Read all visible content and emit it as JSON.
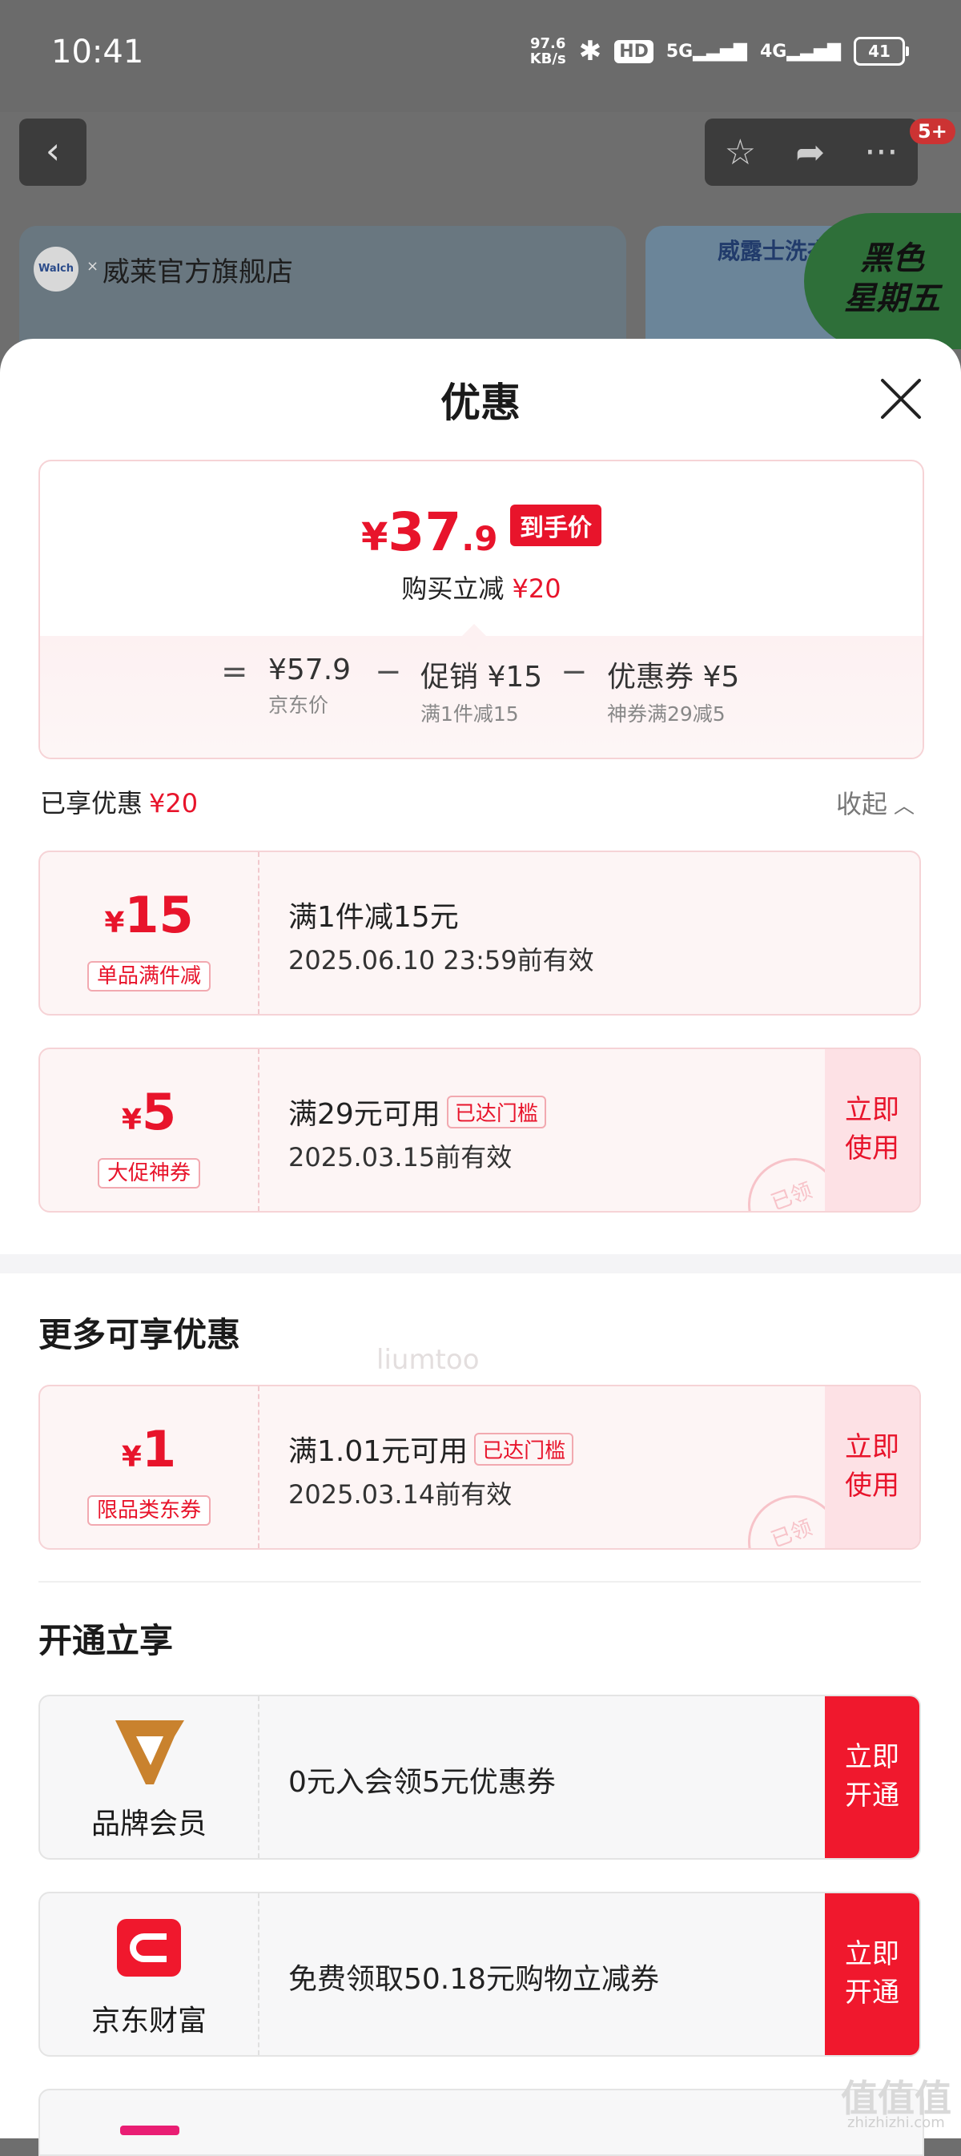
{
  "status_bar": {
    "time": "10:41",
    "net_speed_value": "97.6",
    "net_speed_unit": "KB/s",
    "hd": "HD",
    "sig5g": "5G",
    "sig4g": "4G",
    "battery": "41"
  },
  "background": {
    "store_name": "威莱官方旗舰店",
    "store_logo": "Walch",
    "promo_text": "威露士洗衣",
    "black_friday_line1": "黑色",
    "black_friday_line2": "星期五",
    "msg_badge": "5+"
  },
  "sheet": {
    "title": "优惠",
    "summary": {
      "final_price_yen": "¥",
      "final_price_int": "37",
      "final_price_dec": ".9",
      "final_price_tag": "到手价",
      "buy_reduce_label": "购买立减",
      "buy_reduce_amount": "¥20",
      "equals": "=",
      "minus": "−",
      "jd_price": "¥57.9",
      "jd_price_label": "京东价",
      "promo_value": "促销 ¥15",
      "promo_label": "满1件减15",
      "coupon_value": "优惠券 ¥5",
      "coupon_label": "神券满29减5"
    },
    "enjoyed_label": "已享优惠",
    "enjoyed_amount": "¥20",
    "collapse_label": "收起",
    "coupons": [
      {
        "yen": "¥",
        "amount": "15",
        "tag": "单品满件减",
        "title": "满1件减15元",
        "reach": "",
        "date": "2025.06.10 23:59前有效",
        "use_line1": "",
        "use_line2": ""
      },
      {
        "yen": "¥",
        "amount": "5",
        "tag": "大促神券",
        "title": "满29元可用",
        "reach": "已达门槛",
        "date": "2025.03.15前有效",
        "use_line1": "立即",
        "use_line2": "使用",
        "stamp": "已领"
      }
    ],
    "watermark": "liumtoo",
    "more_title": "更多可享优惠",
    "more_coupons": [
      {
        "yen": "¥",
        "amount": "1",
        "tag": "限品类东券",
        "title": "满1.01元可用",
        "reach": "已达门槛",
        "date": "2025.03.14前有效",
        "use_line1": "立即",
        "use_line2": "使用",
        "stamp": "已领"
      }
    ],
    "open_title": "开通立享",
    "memberships": [
      {
        "icon": "brand-member-icon",
        "name": "品牌会员",
        "text": "0元入会领5元优惠券",
        "btn_line1": "立即",
        "btn_line2": "开通",
        "color": "#c9822e"
      },
      {
        "icon": "jd-finance-icon",
        "name": "京东财富",
        "text": "免费领取50.18元购物立减券",
        "btn_line1": "立即",
        "btn_line2": "开通",
        "color": "#f0182d"
      }
    ]
  },
  "site": {
    "logo": "值值值",
    "url": "zhizhizhi.com"
  }
}
